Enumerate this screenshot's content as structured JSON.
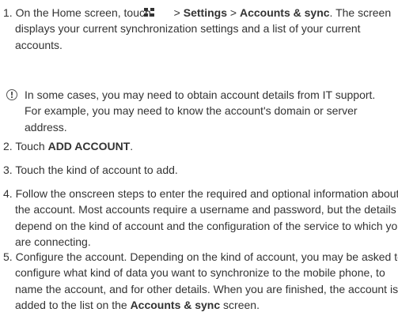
{
  "steps": {
    "s1": {
      "num": "1.",
      "pre": "On the Home screen, touch",
      "mid1": " > ",
      "settings": "Settings",
      "mid2": " > ",
      "accounts_sync": "Accounts & sync",
      "post": ". The screen displays your current synchronization settings and a list of your current accounts."
    },
    "note": {
      "text": "In some cases, you may need to obtain account details from IT support. For example, you may need to know the account's domain or server address."
    },
    "s2": {
      "num": "2.",
      "pre": "Touch ",
      "bold": "ADD ACCOUNT",
      "post": "."
    },
    "s3": {
      "num": "3.",
      "text": "Touch the kind of account to add."
    },
    "s4": {
      "num": "4.",
      "text": "Follow the onscreen steps to enter the required and optional information about the account. Most accounts require a username and password, but the details depend on the kind of account and the configuration of the service to which you are connecting."
    },
    "s5": {
      "num": "5.",
      "pre": "Configure the account. Depending on the kind of account, you may be asked to configure what kind of data you want to synchronize to the mobile phone, to name the account, and for other details. When you are finished, the account is added to the list on the ",
      "bold": "Accounts & sync",
      "post": " screen."
    }
  },
  "icons": {
    "apps": "apps-grid-icon",
    "note": "info-note-icon"
  },
  "colors": {
    "text": "#333333",
    "icon": "#555555"
  }
}
